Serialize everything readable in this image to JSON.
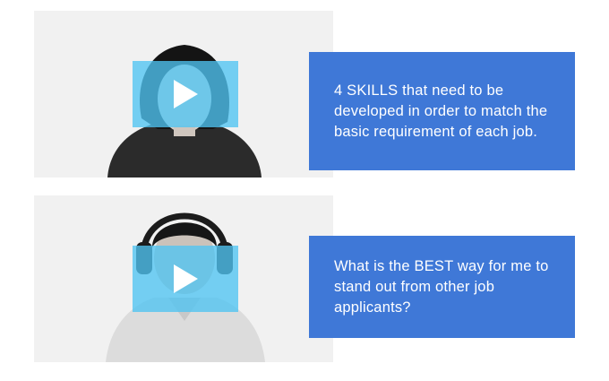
{
  "videos": [
    {
      "thumbnail_icon": "video-thumbnail",
      "play_icon": "play-icon",
      "caption": "4 SKILLS that need to be developed in order to match the basic requirement of each job."
    },
    {
      "thumbnail_icon": "video-thumbnail",
      "play_icon": "play-icon",
      "caption": "What is the BEST way for me to stand out from other job applicants?"
    }
  ],
  "colors": {
    "caption_background": "#3f78d7",
    "play_overlay": "#50c4f2",
    "caption_text": "#ffffff",
    "card_background": "#f1f1f1"
  }
}
